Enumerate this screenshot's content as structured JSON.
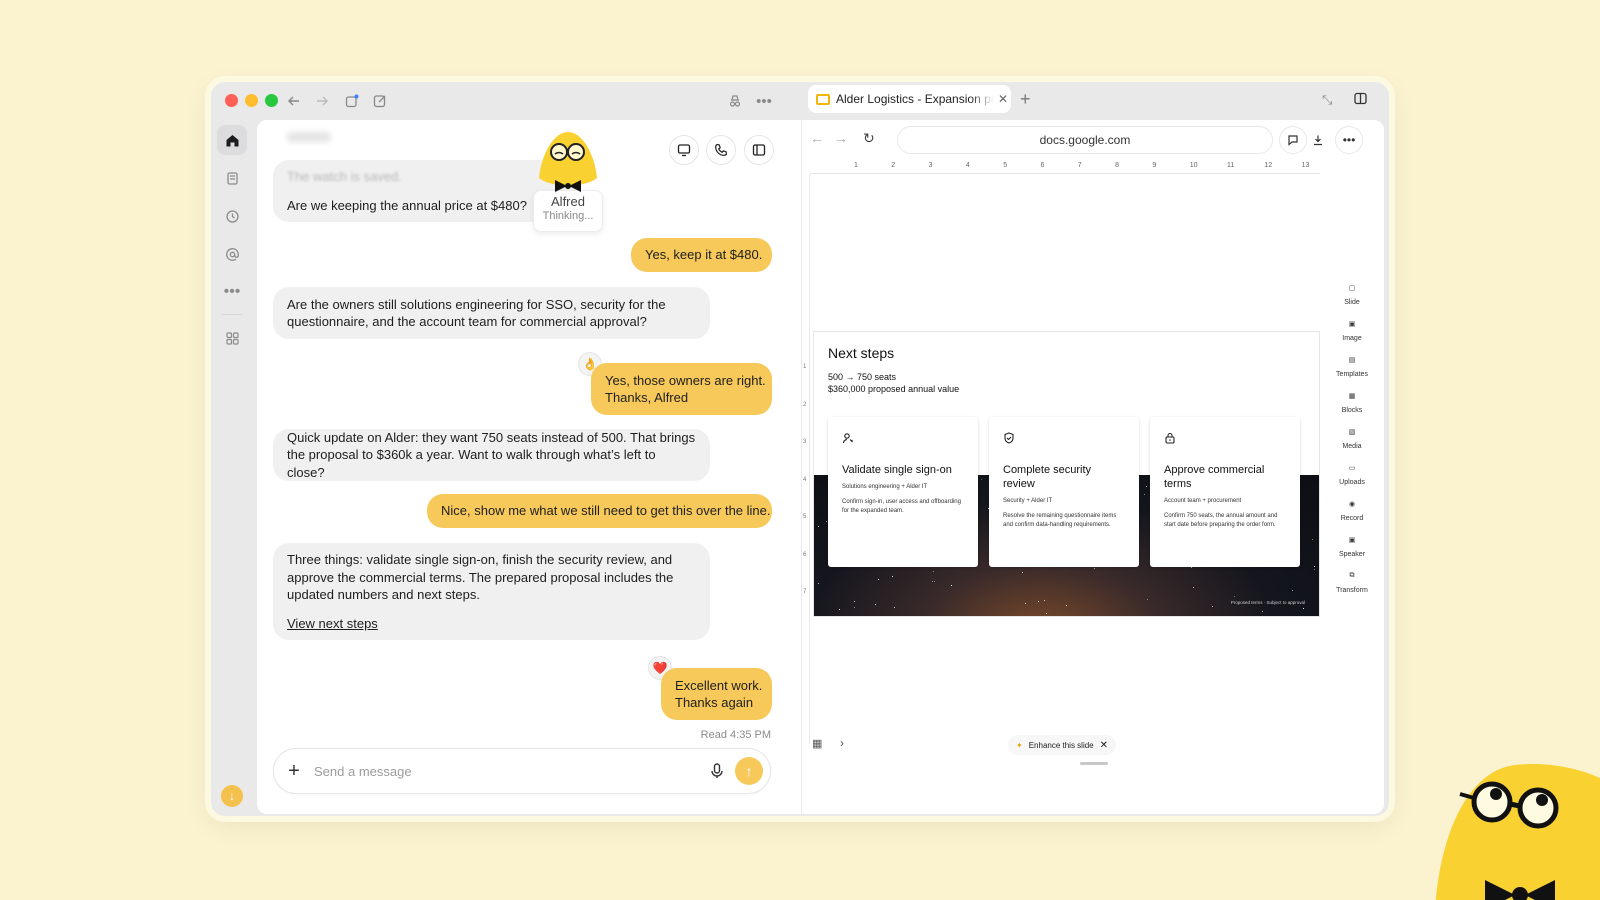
{
  "colors": {
    "background": "#fbf3cf",
    "accent_yellow": "#f7c95a",
    "incoming_bubble": "#f0f0f0",
    "tab_icon": "#f2b705"
  },
  "icons": {
    "sidebar": [
      "home-icon",
      "library-icon",
      "history-icon",
      "at-icon",
      "more-icon",
      "apps-icon"
    ],
    "titlebar": [
      "back-icon",
      "forward-icon",
      "new-tab-icon",
      "compose-icon",
      "incognito-icon",
      "more-icon"
    ],
    "chat_header": [
      "screen-icon",
      "phone-icon",
      "sidebar-toggle-icon"
    ]
  },
  "alfred": {
    "name": "Alfred",
    "status": "Thinking..."
  },
  "chat": {
    "messages": [
      {
        "side": "in",
        "faded": "The watch is saved.",
        "text": "Are we keeping the annual price at $480?"
      },
      {
        "side": "out",
        "text": "Yes, keep it at $480."
      },
      {
        "side": "in",
        "text": "Are the owners still solutions engineering for SSO, security for the questionnaire, and the account team for commercial approval?"
      },
      {
        "side": "out",
        "text_line1": "Yes, those owners are right.",
        "text_line2": "Thanks, Alfred",
        "reaction": "👌"
      },
      {
        "side": "in",
        "text": "Quick update on Alder: they want 750 seats instead of 500. That brings the proposal to $360k a year. Want to walk through what’s left to close?"
      },
      {
        "side": "out",
        "text": "Nice, show me what we still need to get this over the line."
      },
      {
        "side": "in",
        "text": "Three things: validate single sign-on, finish the security review, and approve the commercial terms. The prepared proposal includes the updated numbers and next steps.",
        "link": "View next steps"
      },
      {
        "side": "out",
        "text_line1": "Excellent work.",
        "text_line2": "Thanks again",
        "reaction": "❤️"
      }
    ],
    "read_receipt": "Read 4:35 PM",
    "composer_placeholder": "Send a message"
  },
  "browser": {
    "tab_title": "Alder Logistics - Expansion proposal",
    "url": "docs.google.com",
    "ruler_numbers": [
      "1",
      "2",
      "3",
      "4",
      "5",
      "6",
      "7",
      "8",
      "9",
      "10",
      "11",
      "12",
      "13"
    ],
    "vruler_numbers": [
      "1",
      "2",
      "3",
      "4",
      "5",
      "6",
      "7"
    ]
  },
  "slide": {
    "title": "Next steps",
    "subtitle_line1": "500 → 750 seats",
    "subtitle_line2": "$360,000 proposed annual value",
    "cards": [
      {
        "icon": "user-key-icon",
        "title": "Validate single sign-on",
        "owner": "Solutions engineering + Alder IT",
        "desc": "Confirm sign-in, user access and offboarding for the expanded team."
      },
      {
        "icon": "shield-check-icon",
        "title": "Complete security review",
        "owner": "Security + Alder IT",
        "desc": "Resolve the remaining questionnaire items and confirm data-handling requirements."
      },
      {
        "icon": "lock-icon",
        "title": "Approve commercial terms",
        "owner": "Account team + procurement",
        "desc": "Confirm 750 seats, the annual amount and start date before preparing the order form."
      }
    ],
    "footer": "Proposed terms · Subject to approval"
  },
  "tools": [
    "Slide",
    "Image",
    "Templates",
    "Blocks",
    "Media",
    "Uploads",
    "Record",
    "Speaker",
    "Transform"
  ],
  "enhance": {
    "label": "Enhance this slide"
  }
}
